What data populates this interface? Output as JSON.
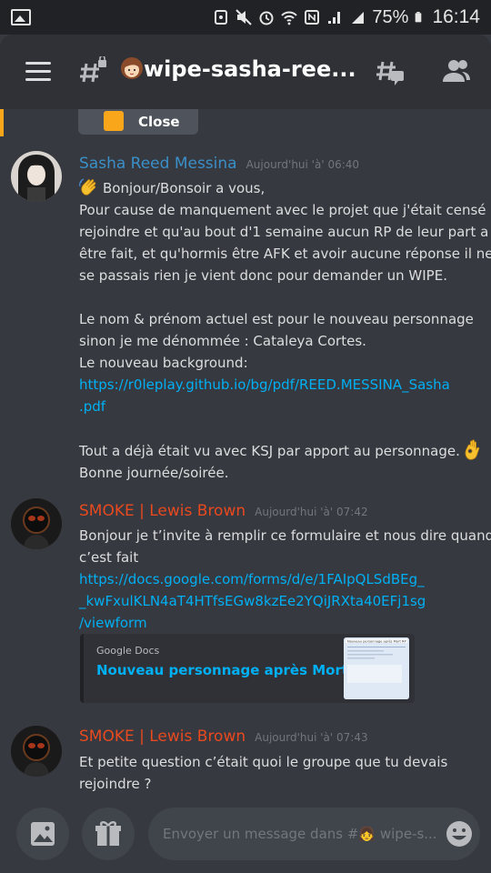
{
  "status_bar": {
    "battery_percent": "75%",
    "time": "16:14"
  },
  "header": {
    "channel_name": "wipe-sasha-ree..."
  },
  "close_pill": {
    "label": "Close"
  },
  "messages": [
    {
      "author": "Sasha Reed Messina",
      "author_color": "#3b8fc9",
      "timestamp": "Aujourd'hui 'à' 06:40",
      "lines": [
        "Bonjour/Bonsoir a vous,",
        "Pour cause de manquement avec le projet que j'était censé",
        "rejoindre et qu'au bout d'1 semaine aucun RP de leur part a pu",
        "être fait, et qu'hormis être AFK et avoir aucune réponse il ne",
        "se passais rien je vient donc pour demander un WIPE.",
        "",
        "Le nom & prénom actuel est pour le nouveau personnage",
        "sinon je me dénommée : Cataleya Cortes.",
        "Le nouveau background:"
      ],
      "link_lines": [
        "https://r0leplay.github.io/bg/pdf/REED.MESSINA_Sasha",
        ".pdf"
      ],
      "tail_lines": [
        "Tout a déjà était vu avec KSJ par apport au personnage.",
        "Bonne journée/soirée."
      ]
    },
    {
      "author": "SMOKE | Lewis Brown",
      "author_color": "#e8491f",
      "timestamp": "Aujourd'hui 'à' 07:42",
      "lines": [
        "Bonjour je t’invite à remplir ce formulaire et nous dire quand",
        "c’est fait"
      ],
      "link_lines": [
        "https://docs.google.com/forms/d/e/1FAIpQLSdBEg_",
        "_kwFxulKLN4aT4HTfsEGw8kzEe2YQiJRXta40EFj1sg",
        "/viewform"
      ],
      "embed": {
        "provider": "Google Docs",
        "title": "Nouveau personnage après Mort RP",
        "thumb_caption": "Nouveau personnage après Mort RP"
      }
    },
    {
      "author": "SMOKE | Lewis Brown",
      "author_color": "#e8491f",
      "timestamp": "Aujourd'hui 'à' 07:43",
      "lines": [
        "Et petite question c’était quoi le groupe que tu devais",
        "rejoindre ?"
      ]
    }
  ],
  "composer": {
    "placeholder": "Envoyer un message dans #👧 wipe-s..."
  },
  "colors": {
    "background": "#36393f",
    "header": "#2f3136",
    "link": "#00b0f4",
    "accent_orange": "#faa61a"
  }
}
